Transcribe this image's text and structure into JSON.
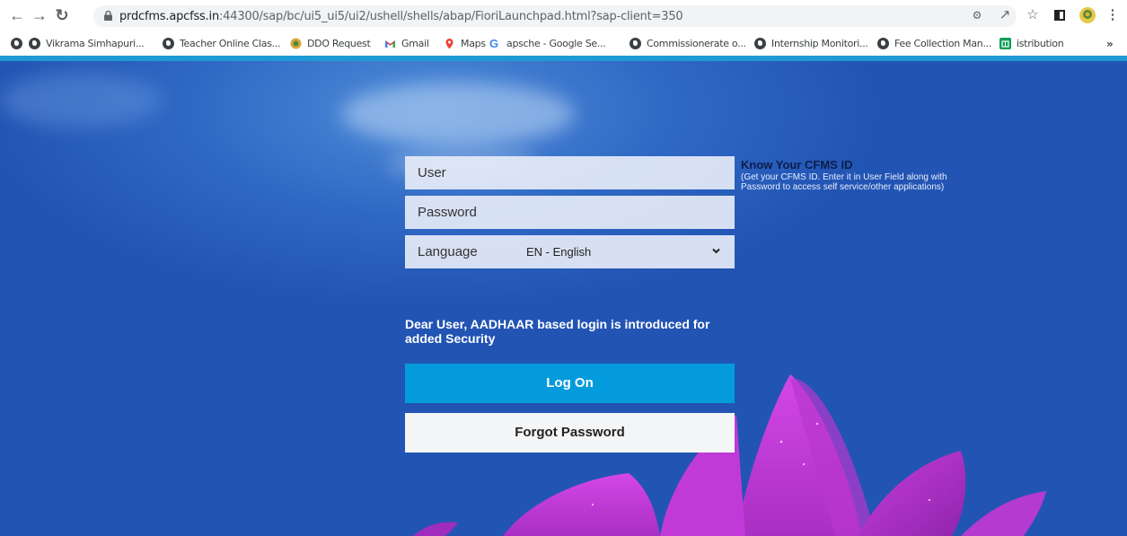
{
  "browser": {
    "url_host": "prdcfms.apcfss.in",
    "url_rest": ":44300/sap/bc/ui5_ui5/ui2/ushell/shells/abap/FioriLaunchpad.html?sap-client=350",
    "bookmarks": [
      {
        "label": "Vikrama Simhapuri...",
        "icon": "globe-icon"
      },
      {
        "label": "Teacher Online Clas...",
        "icon": "globe-icon"
      },
      {
        "label": "DDO Request",
        "icon": "ddo-logo-icon"
      },
      {
        "label": "Gmail",
        "icon": "gmail-icon"
      },
      {
        "label": "Maps",
        "icon": "maps-icon"
      },
      {
        "label": "apsche - Google Se...",
        "icon": "google-icon"
      },
      {
        "label": "Commissionerate o...",
        "icon": "globe-icon"
      },
      {
        "label": "Internship Monitori...",
        "icon": "globe-icon"
      },
      {
        "label": "Fee Collection Man...",
        "icon": "globe-icon"
      },
      {
        "label": "istribution",
        "icon": "sheets-icon"
      }
    ],
    "more_bookmarks": "»"
  },
  "login": {
    "user_placeholder": "User",
    "password_placeholder": "Password",
    "language_label": "Language",
    "language_value": "EN - English",
    "notice": "Dear User, AADHAAR based login is introduced for added Security",
    "logon_label": "Log On",
    "forgot_label": "Forgot Password"
  },
  "cfms_help": {
    "title": "Know Your CFMS ID",
    "description": "(Get your CFMS ID. Enter it in User Field along with Password to access self service/other applications)"
  },
  "colors": {
    "background": "#2254b3",
    "accent": "#049bdc",
    "flower": "#c23bd6"
  }
}
